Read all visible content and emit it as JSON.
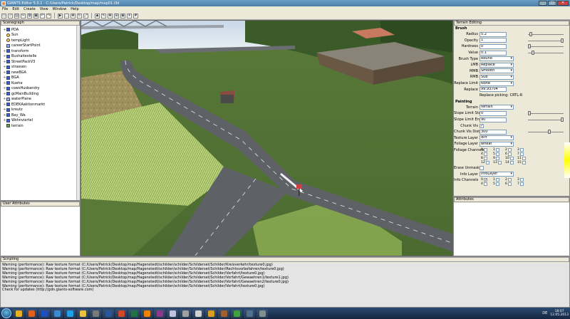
{
  "window": {
    "title": "GIANTS Editor 5.0.1 - C:/Users/Patrick/Desktop/map/map01.i3d",
    "buttons": [
      "_",
      "□",
      "✕"
    ]
  },
  "menu": [
    "File",
    "Edit",
    "Create",
    "View",
    "Window",
    "Help"
  ],
  "toolbar": {
    "icons": [
      "new-icon",
      "open-icon",
      "save-icon",
      "cut-icon",
      "copy-icon",
      "paste-icon",
      "undo-icon",
      "redo-icon",
      "play-icon",
      "select-icon",
      "move-icon",
      "rotate-icon",
      "scale-icon",
      "terrain-sculpt-icon",
      "terrain-paint-icon",
      "foliage-icon",
      "snap-icon",
      "camera-icon",
      "light-icon",
      "grid-icon"
    ]
  },
  "scenegraph": {
    "title": "Scenegraph",
    "items": [
      {
        "label": "PDA",
        "icon": "transformgroup",
        "expand": "+"
      },
      {
        "label": "Sun",
        "icon": "light",
        "expand": ""
      },
      {
        "label": "tempLight",
        "icon": "light",
        "expand": ""
      },
      {
        "label": "careerStartPoint",
        "icon": "shape",
        "expand": ""
      },
      {
        "label": "transform",
        "icon": "transformgroup",
        "expand": "+"
      },
      {
        "label": "Bushaltestelle",
        "icon": "transformgroup",
        "expand": "+"
      },
      {
        "label": "StreetPackV3",
        "icon": "transformgroup",
        "expand": "+"
      },
      {
        "label": "strassen",
        "icon": "transformgroup",
        "expand": "+"
      },
      {
        "label": "newBGA",
        "icon": "transformgroup",
        "expand": "+"
      },
      {
        "label": "BGA",
        "icon": "transformgroup",
        "expand": "+"
      },
      {
        "label": "Kuehe",
        "icon": "transformgroup",
        "expand": "+"
      },
      {
        "label": "cowsHusbandry",
        "icon": "transformgroup",
        "expand": "+"
      },
      {
        "label": "gcMainBuilding",
        "icon": "transformgroup",
        "expand": "+"
      },
      {
        "label": "waterPlane",
        "icon": "shape",
        "expand": "+"
      },
      {
        "label": "EDEKAaktionmarkt",
        "icon": "transformgroup",
        "expand": "+"
      },
      {
        "label": "kreutz",
        "icon": "transformgroup",
        "expand": "+"
      },
      {
        "label": "Bay_Wa",
        "icon": "transformgroup",
        "expand": "+"
      },
      {
        "label": "Wohnviertel",
        "icon": "transformgroup",
        "expand": "+"
      },
      {
        "label": "terrain",
        "icon": "terrain",
        "expand": ""
      }
    ]
  },
  "user_attributes": {
    "title": "User Attributes"
  },
  "terrain_editing": {
    "title": "Terrain Editing",
    "brush_header": "Brush",
    "radius": {
      "label": "Radius",
      "value": "5.2",
      "level": 0.05
    },
    "opacity": {
      "label": "Opacity",
      "value": "1",
      "level": 1.0
    },
    "hardness": {
      "label": "Hardness",
      "value": "0",
      "level": 0.0
    },
    "value": {
      "label": "Value",
      "value": "0.1",
      "level": 0.1
    },
    "brush_type": {
      "label": "Brush Type",
      "value": "Round"
    },
    "lmb": {
      "label": "LMB",
      "value": "Replace"
    },
    "mmb": {
      "label": "MMB",
      "value": "Smooth"
    },
    "rmb": {
      "label": "RMB",
      "value": "Sub"
    },
    "replace_limit": {
      "label": "Replace Limit",
      "value": "None"
    },
    "replace": {
      "label": "Replace",
      "value": "99.93704"
    },
    "replace_picking": "Replace picking: CRTL-R",
    "painting_header": "Painting",
    "terrain": {
      "label": "Terrain",
      "value": "terrain"
    },
    "slope_start": {
      "label": "Slope Limit Start",
      "value": "0",
      "level": 0.0
    },
    "slope_end": {
      "label": "Slope Limit End",
      "value": "90",
      "level": 1.0
    },
    "chunk_vis": {
      "label": "Chunk Vis",
      "checked": true
    },
    "chunk_vis_dist": {
      "label": "Chunk Vis Dist",
      "value": "300",
      "level": 0.6
    },
    "texture_layer": {
      "label": "Texture Layer",
      "value": "dirt"
    },
    "foliage_layer": {
      "label": "Foliage Layer",
      "value": "wheat"
    },
    "foliage_channels": {
      "label": "Foliage Channels",
      "numbers": [
        "0",
        "1",
        "2",
        "3",
        "4",
        "5",
        "6",
        "7",
        "8",
        "9",
        "10",
        "11",
        "12",
        "13",
        "14",
        "15"
      ]
    },
    "erase_unmasked": {
      "label": "Erase Unmasked",
      "checked": false
    },
    "info_layer": {
      "label": "Info Layer",
      "value": "infoLayer"
    },
    "info_channels": {
      "label": "Info Channels",
      "numbers": [
        "0",
        "1",
        "2",
        "3",
        "4",
        "5",
        "6",
        "7"
      ]
    }
  },
  "attributes": {
    "title": "Attributes"
  },
  "scripting": {
    "title": "Scripting",
    "lines": [
      "Warning (performance): Raw texture format (C:/Users/Patrick/Desktop/map/Hagenstedt/schilder/schilder/Schilderset/Schilder/Kreisverkehr/texture0.jpg)",
      "Warning (performance): Raw texture format (C:/Users/Patrick/Desktop/map/Hagenstedt/schilder/schilder/Schilderset/Schilder/Rechtsvorbefahren/texture0.jpg)",
      "Warning (performance): Raw texture format (C:/Users/Patrick/Desktop/map/Hagenstedt/schilder/schilder/Schilderset/Schilder/Vorfahrt/texture0.jpg)",
      "Warning (performance): Raw texture format (C:/Users/Patrick/Desktop/map/Hagenstedt/schilder/schilder/Schilderset/Schilder/Vorfahrt/Gewaehren1/texture1.jpg)",
      "Warning (performance): Raw texture format (C:/Users/Patrick/Desktop/map/Hagenstedt/schilder/schilder/Schilderset/Schilder/Vorfahrt/Gewaehren2/texture0.jpg)",
      "Warning (performance): Raw texture format (C:/Users/Patrick/Desktop/map/Hagenstedt/schilder/schilder/Schilderset/Schilder/Vorfahrt/texture0.jpg)",
      "Check for updates (http://gdn.giants-software.com)"
    ]
  },
  "taskbar": {
    "apps": [
      {
        "name": "chrome-icon",
        "color": "#e8b020"
      },
      {
        "name": "firefox-icon",
        "color": "#e06020"
      },
      {
        "name": "outlook-icon",
        "color": "#2050c0"
      },
      {
        "name": "image-viewer-icon",
        "color": "#3a8ad0"
      },
      {
        "name": "skype-icon",
        "color": "#20a0e8"
      },
      {
        "name": "explorer-icon",
        "color": "#e8c040"
      },
      {
        "name": "calculator-icon",
        "color": "#7a7a7a"
      },
      {
        "name": "word-icon",
        "color": "#2b579a"
      },
      {
        "name": "powerpoint-icon",
        "color": "#d24726"
      },
      {
        "name": "excel-icon",
        "color": "#217346"
      },
      {
        "name": "vlc-icon",
        "color": "#f08000"
      },
      {
        "name": "winrar-icon",
        "color": "#8a3a8a"
      },
      {
        "name": "paint-icon",
        "color": "#c0c0e0"
      },
      {
        "name": "tool-icon",
        "color": "#a0a0a0"
      },
      {
        "name": "burn-icon",
        "color": "#d0d0d0"
      },
      {
        "name": "giants-editor-icon",
        "color": "#d8a020"
      },
      {
        "name": "game-icon",
        "color": "#a06030"
      },
      {
        "name": "tractor-icon",
        "color": "#40a040"
      },
      {
        "name": "photo-icon",
        "color": "#507090"
      },
      {
        "name": "settings-icon",
        "color": "#809090"
      }
    ],
    "tray": {
      "lang": "DE",
      "time": "18:07",
      "date": "12.05.2013"
    }
  }
}
